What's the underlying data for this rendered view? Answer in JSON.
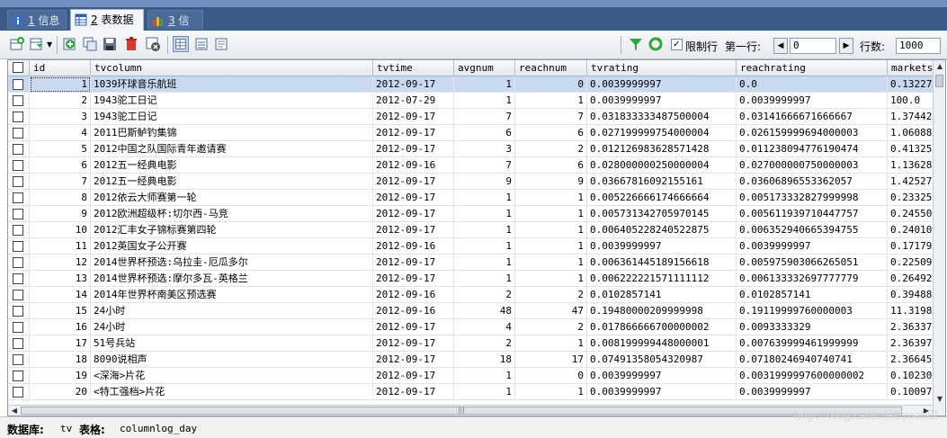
{
  "tabs": [
    {
      "num": "1",
      "label": " 信息",
      "active": false
    },
    {
      "num": "2",
      "label": " 表数据",
      "active": true
    },
    {
      "num": "3",
      "label": " 信息",
      "active": false
    }
  ],
  "toolbar": {
    "limit_label": "限制行",
    "first_row_label": "第一行:",
    "first_row_value": "0",
    "row_count_label": "行数:",
    "row_count_value": "1000",
    "prev_arrow": "◀",
    "next_arrow": "▶"
  },
  "grid": {
    "columns": [
      "id",
      "tvcolumn",
      "tvtime",
      "avgnum",
      "reachnum",
      "tvrating",
      "reachrating",
      "marketshare"
    ],
    "rows": [
      [
        "1",
        "1039环球音乐航班",
        "2012-09-17",
        "1",
        "0",
        "0.0039999997",
        "0.0",
        "0.13227"
      ],
      [
        "2",
        "1943驼工日记",
        "2012-07-29",
        "1",
        "1",
        "0.0039999997",
        "0.0039999997",
        "100.0"
      ],
      [
        "3",
        "1943驼工日记",
        "2012-09-17",
        "7",
        "7",
        "0.031833333487500004",
        "0.03141666671666667",
        "1.37442"
      ],
      [
        "4",
        "2011巴斯鲈钓集锦",
        "2012-09-17",
        "6",
        "6",
        "0.027199999754000004",
        "0.026159999694000003",
        "1.06088"
      ],
      [
        "5",
        "2012中国之队国际青年邀请赛",
        "2012-09-17",
        "3",
        "2",
        "0.012126983628571428",
        "0.011238094776190474",
        "0.41325"
      ],
      [
        "6",
        "2012五一经典电影",
        "2012-09-16",
        "7",
        "6",
        "0.028000000250000004",
        "0.027000000750000003",
        "1.13628"
      ],
      [
        "7",
        "2012五一经典电影",
        "2012-09-17",
        "9",
        "9",
        "0.03667816092155161",
        "0.03606896553362057",
        "1.42527"
      ],
      [
        "8",
        "2012依云大师赛第一轮",
        "2012-09-17",
        "1",
        "1",
        "0.005226666174666664",
        "0.005173332827999998",
        "0.23325"
      ],
      [
        "9",
        "2012欧洲超级杯:切尔西-马竞",
        "2012-09-17",
        "1",
        "1",
        "0.005731342705970145",
        "0.005611939710447757",
        "0.24550"
      ],
      [
        "10",
        "2012汇丰女子锦标赛第四轮",
        "2012-09-17",
        "1",
        "1",
        "0.006405228240522875",
        "0.006352940665394755",
        "0.24010"
      ],
      [
        "11",
        "2012英国女子公开赛",
        "2012-09-16",
        "1",
        "1",
        "0.0039999997",
        "0.0039999997",
        "0.17179"
      ],
      [
        "12",
        "2014世界杯预选:乌拉圭-厄瓜多尔",
        "2012-09-17",
        "1",
        "1",
        "0.006361445189156618",
        "0.005975903066265051",
        "0.22509"
      ],
      [
        "13",
        "2014世界杯预选:摩尔多瓦-英格兰",
        "2012-09-17",
        "1",
        "1",
        "0.006222221571111112",
        "0.006133332697777779",
        "0.26492"
      ],
      [
        "14",
        "2014年世界杯南美区预选赛",
        "2012-09-16",
        "2",
        "2",
        "0.0102857141",
        "0.0102857141",
        "0.39488"
      ],
      [
        "15",
        "24小时",
        "2012-09-16",
        "48",
        "47",
        "0.19480000209999998",
        "0.19119999760000003",
        "11.3198"
      ],
      [
        "16",
        "24小时",
        "2012-09-17",
        "4",
        "2",
        "0.017866666700000002",
        "0.0093333329",
        "2.36337"
      ],
      [
        "17",
        "51号兵站",
        "2012-09-17",
        "2",
        "1",
        "0.008199999448000001",
        "0.007639999461999999",
        "2.36397"
      ],
      [
        "18",
        "8090说相声",
        "2012-09-17",
        "18",
        "17",
        "0.07491358054320987",
        "0.07180246940740741",
        "2.36645"
      ],
      [
        "19",
        "<深海>片花",
        "2012-09-17",
        "1",
        "0",
        "0.0039999997",
        "0.0031999997600000002",
        "0.10230"
      ],
      [
        "20",
        "<特工强档>片花",
        "2012-09-17",
        "1",
        "1",
        "0.0039999997",
        "0.0039999997",
        "0.10097"
      ]
    ]
  },
  "status": {
    "db_label": "数据库:",
    "db_value": "tv",
    "table_label": "表格:",
    "table_value": "columnlog_day"
  },
  "watermark": "http://blog.csdn.net/zoetell"
}
